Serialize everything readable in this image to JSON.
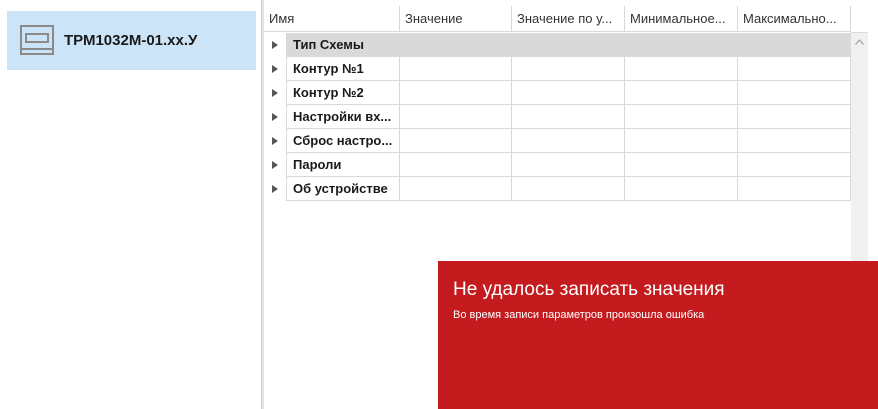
{
  "device_panel": {
    "items": [
      {
        "label": "ТРМ1032М-01.хх.У",
        "icon": "device-icon",
        "selected": true
      }
    ],
    "selected_color": "#cce4f7"
  },
  "grid": {
    "columns": [
      "Имя",
      "Значение",
      "Значение по у...",
      "Минимальное...",
      "Максимально..."
    ],
    "rows": [
      {
        "name": "Тип Схемы",
        "selected": true
      },
      {
        "name": "Контур №1"
      },
      {
        "name": "Контур №2"
      },
      {
        "name": "Настройки вх..."
      },
      {
        "name": "Сброс настро..."
      },
      {
        "name": "Пароли"
      },
      {
        "name": "Об устройстве"
      }
    ]
  },
  "toast": {
    "title": "Не удалось записать значения",
    "message": "Во время записи параметров произошла ошибка",
    "color": "#c41b1f"
  }
}
